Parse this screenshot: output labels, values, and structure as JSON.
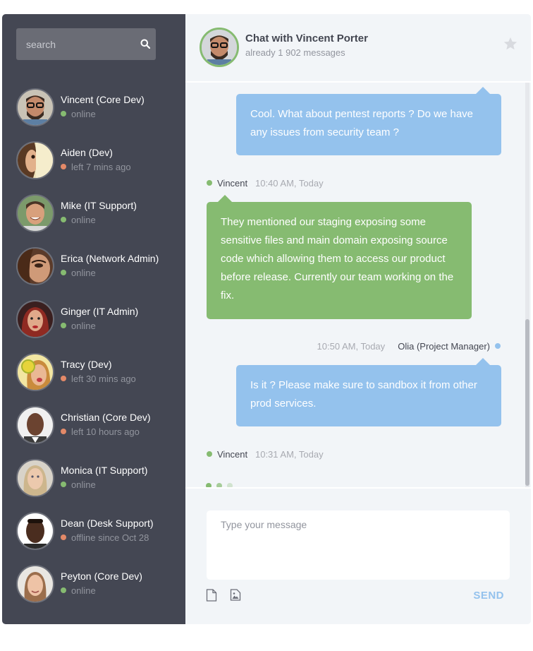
{
  "sidebar": {
    "search_placeholder": "search",
    "contacts": [
      {
        "name": "Vincent (Core Dev)",
        "status": "online",
        "state": "online"
      },
      {
        "name": "Aiden (Dev)",
        "status": "left 7 mins ago",
        "state": "away"
      },
      {
        "name": "Mike (IT Support)",
        "status": "online",
        "state": "online"
      },
      {
        "name": "Erica (Network Admin)",
        "status": "online",
        "state": "online"
      },
      {
        "name": "Ginger (IT Admin)",
        "status": "online",
        "state": "online"
      },
      {
        "name": "Tracy (Dev)",
        "status": "left 30 mins ago",
        "state": "away"
      },
      {
        "name": "Christian (Core Dev)",
        "status": "left 10 hours ago",
        "state": "away"
      },
      {
        "name": "Monica (IT Support)",
        "status": "online",
        "state": "online"
      },
      {
        "name": "Dean (Desk Support)",
        "status": "offline since Oct 28",
        "state": "away"
      },
      {
        "name": "Peyton (Core Dev)",
        "status": "online",
        "state": "online"
      }
    ]
  },
  "chat": {
    "title": "Chat with Vincent Porter",
    "subtitle": "already 1 902 messages",
    "messages": [
      {
        "text": "Cool. What about pentest reports ? Do we have any issues from security team ?"
      },
      {
        "author": "Vincent",
        "time": "10:40 AM, Today",
        "text": "They mentioned our staging exposing some sensitive files and main domain exposing source code which allowing them to access our product before release. Currently our team working on the fix."
      },
      {
        "author": "Olia (Project Manager)",
        "time": "10:50 AM, Today",
        "text": "Is it ? Please make sure to sandbox it from other prod services."
      },
      {
        "author": "Vincent",
        "time": "10:31 AM, Today"
      }
    ],
    "composer": {
      "placeholder": "Type your message",
      "send_label": "SEND"
    }
  },
  "colors": {
    "sidebar_bg": "#444753",
    "online": "#86bb71",
    "away": "#e38968",
    "other_bubble": "#94c2ed",
    "mine_bubble": "#86bb71"
  },
  "icons": [
    "search-icon",
    "star-icon",
    "file-icon",
    "image-icon"
  ]
}
